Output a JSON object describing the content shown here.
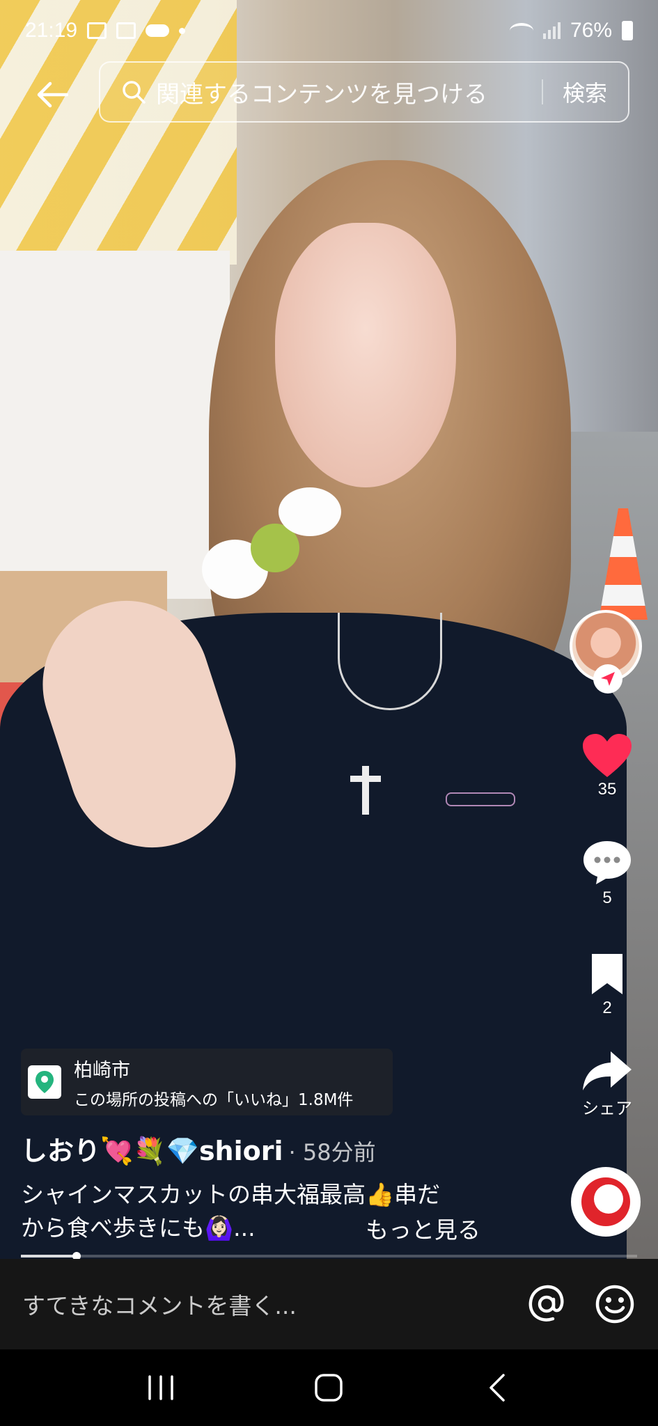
{
  "status_bar": {
    "time": "21:19",
    "battery": "76%"
  },
  "search": {
    "placeholder": "関連するコンテンツを見つける",
    "submit_label": "検索"
  },
  "actions": {
    "like_count": "35",
    "comment_count": "5",
    "bookmark_count": "2",
    "share_label": "シェア"
  },
  "location": {
    "name": "柏崎市",
    "subtitle": "この場所の投稿への「いいね」1.8M件"
  },
  "post": {
    "author": "しおり💘💐💎shiori",
    "time": "· 58分前",
    "caption_line1": "シャインマスカットの串大福最高👍串だ",
    "caption_line2": "から食べ歩きにも🙆🏻‍♀️...",
    "more_label": "もっと見る",
    "progress": 0.09
  },
  "comment": {
    "placeholder": "すてきなコメントを書く..."
  },
  "colors": {
    "like": "#fe2c55",
    "location": "#24b47e",
    "follow": "#fe2c55"
  },
  "icons": [
    "back-arrow-icon",
    "search-icon",
    "heart-icon",
    "comment-icon",
    "bookmark-icon",
    "share-icon",
    "location-pin-icon",
    "at-icon",
    "emoji-icon",
    "recent-apps-icon",
    "home-icon",
    "back-icon"
  ]
}
